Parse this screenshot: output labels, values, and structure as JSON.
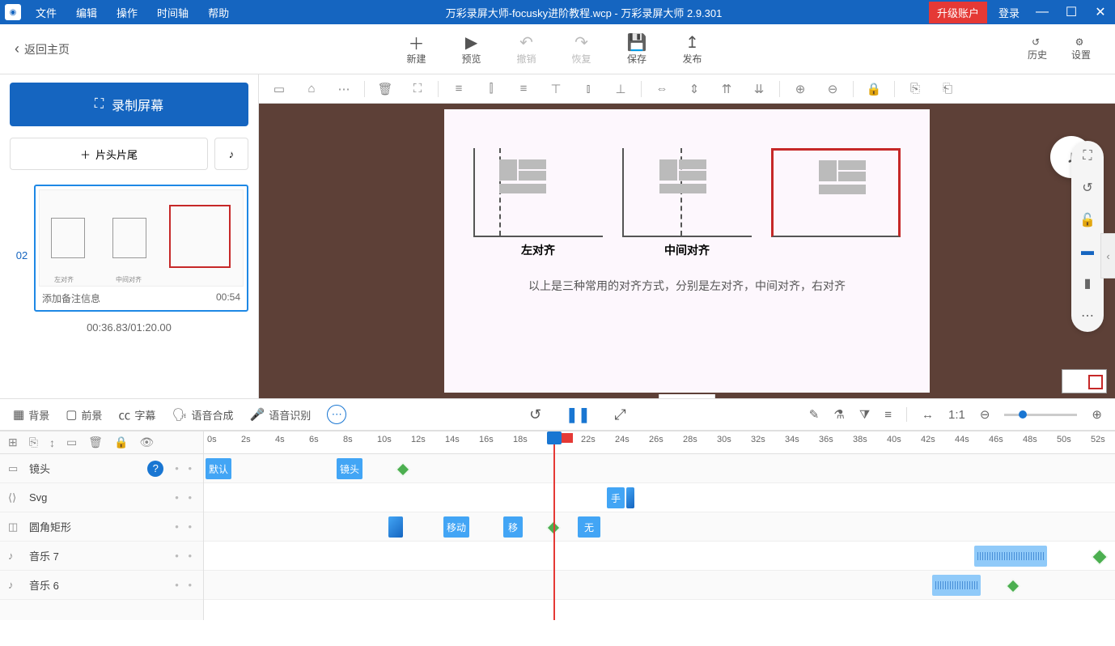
{
  "titlebar": {
    "menus": [
      "文件",
      "编辑",
      "操作",
      "时间轴",
      "帮助"
    ],
    "title": "万彩录屏大师-focusky进阶教程.wcp - 万彩录屏大师 2.9.301",
    "upgrade": "升级账户",
    "login": "登录"
  },
  "header": {
    "back": "返回主页",
    "tools": [
      {
        "icon": "＋",
        "label": "新建"
      },
      {
        "icon": "▶",
        "label": "预览"
      },
      {
        "icon": "↶",
        "label": "撤销",
        "disabled": true
      },
      {
        "icon": "↷",
        "label": "恢复",
        "disabled": true
      },
      {
        "icon": "💾",
        "label": "保存"
      },
      {
        "icon": "↥",
        "label": "发布"
      }
    ],
    "history": "历史",
    "settings": "设置"
  },
  "sidebar": {
    "record": "录制屏幕",
    "intro": "片头片尾",
    "thumb_num": "02",
    "note": "添加备注信息",
    "duration": "00:54",
    "total": "00:36.83/01:20.00"
  },
  "slide": {
    "labels": [
      "左对齐",
      "中间对齐",
      ""
    ],
    "caption": "以上是三种常用的对齐方式，分别是左对齐，中间对齐，右对齐"
  },
  "timeline_tabs": {
    "items": [
      "背景",
      "前景",
      "字幕",
      "语音合成",
      "语音识别"
    ]
  },
  "ruler_ticks": [
    "0s",
    "2s",
    "4s",
    "6s",
    "8s",
    "10s",
    "12s",
    "14s",
    "16s",
    "18s",
    "20s",
    "22s",
    "24s",
    "26s",
    "28s",
    "30s",
    "32s",
    "34s",
    "36s",
    "38s",
    "40s",
    "42s",
    "44s",
    "46s",
    "48s",
    "50s",
    "52s"
  ],
  "tracks": [
    {
      "icon": "▭",
      "label": "镜头",
      "help": true
    },
    {
      "icon": "⟨⟩",
      "label": "Svg"
    },
    {
      "icon": "◫",
      "label": "圆角矩形"
    },
    {
      "icon": "♪",
      "label": "音乐 7"
    },
    {
      "icon": "♪",
      "label": "音乐 6"
    }
  ],
  "clips": {
    "default": "默认",
    "shot": "镜头",
    "hand": "手",
    "move": "移动",
    "move2": "移",
    "none": "无"
  }
}
